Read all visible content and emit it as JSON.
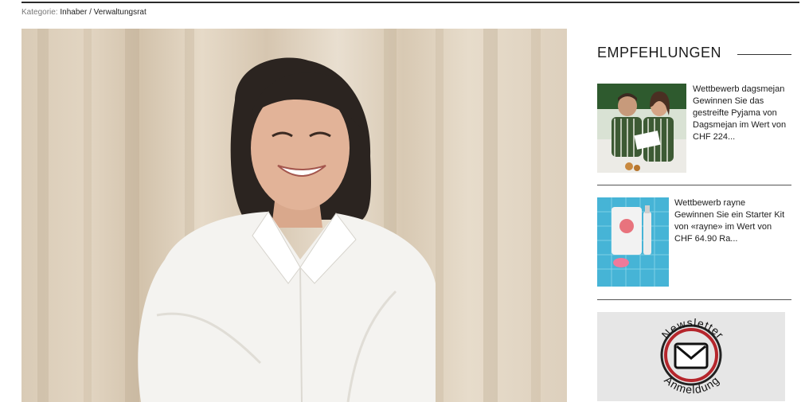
{
  "category": {
    "label": "Kategorie:",
    "value": "Inhaber / Verwaltungsrat"
  },
  "sidebar": {
    "title": "EMPFEHLUNGEN",
    "items": [
      {
        "kicker": "Wettbewerb dagsmejan",
        "description": "Gewinnen Sie das gestreifte Pyjama von Dagsmejan im Wert von CHF 224..."
      },
      {
        "kicker": "Wettbewerb rayne",
        "description": "Gewinnen Sie ein Starter Kit von «rayne» im Wert von CHF 64.90 Ra..."
      }
    ],
    "newsletter": {
      "top_text": "Newsletter",
      "bottom_text": "Anmeldung"
    }
  },
  "colors": {
    "accent_red": "#b5262c",
    "divider": "#555555"
  }
}
